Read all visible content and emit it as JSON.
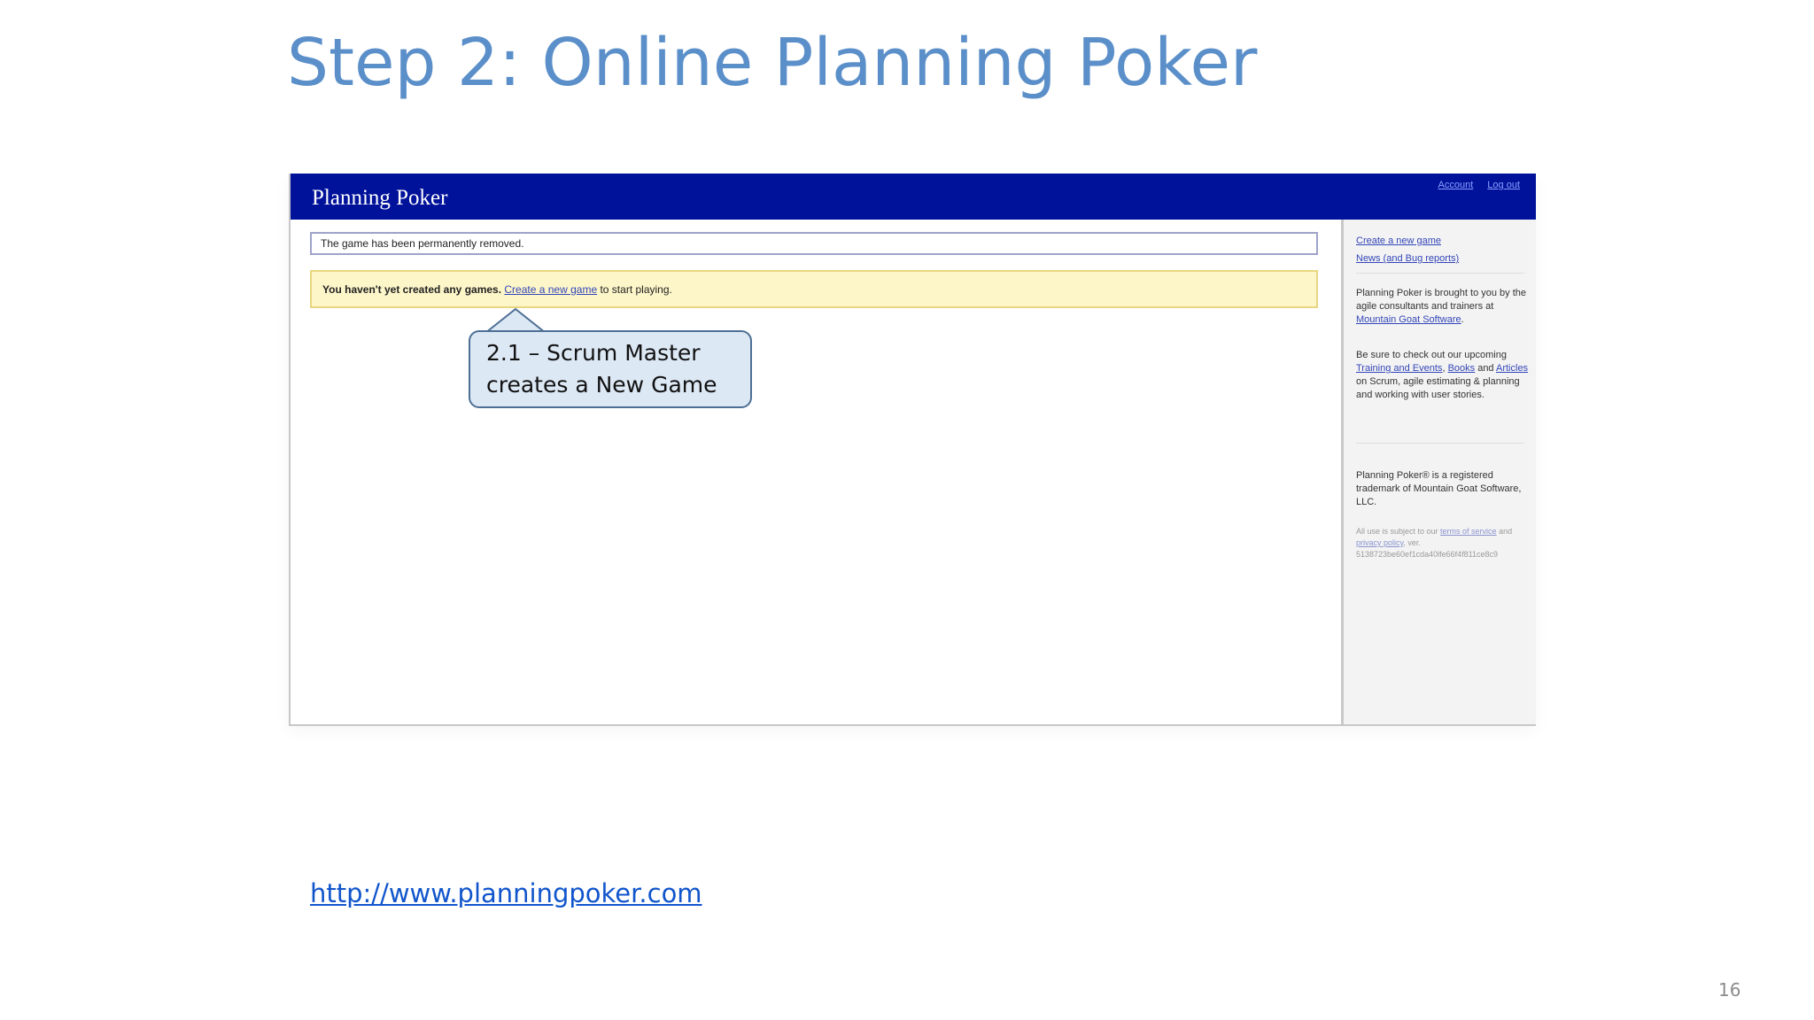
{
  "slide": {
    "title": "Step 2: Online Planning Poker",
    "url": "http://www.planningpoker.com",
    "page_number": "16"
  },
  "site": {
    "title": "Planning Poker",
    "header_links": {
      "account": "Account",
      "logout": "Log out"
    },
    "notice": "The game has been permanently removed.",
    "info": {
      "bold_text": "You haven't yet created any games.",
      "link_text": "Create a new game",
      "suffix": " to start playing."
    },
    "sidebar": {
      "links": [
        "Create a new game",
        "News (and Bug reports)"
      ],
      "about_pre": "Planning Poker is brought to you by the agile consultants and trainers at ",
      "about_link": "Mountain Goat Software",
      "about_post": ".",
      "checkout_pre": "Be sure to check out our upcoming ",
      "checkout_link1": "Training and Events",
      "checkout_sep1": ", ",
      "checkout_link2": "Books",
      "checkout_sep2": " and ",
      "checkout_link3": "Articles",
      "checkout_post": " on Scrum, agile estimating & planning and working with user stories.",
      "trademark": "Planning Poker® is a registered trademark of Mountain Goat Software, LLC.",
      "fine_pre": "All use is subject to our ",
      "fine_link1": "terms of service",
      "fine_sep": " and ",
      "fine_link2": "privacy policy",
      "fine_post": ", ver.",
      "fine_hash": "5138723be60ef1cda40lfe66f4f811ce8c9"
    }
  },
  "callout": {
    "line1": "2.1 – Scrum Master",
    "line2": "creates a New Game"
  },
  "colors": {
    "title": "#5b8fc9",
    "site_header": "#00129a",
    "info_bar": "#fdf6c9",
    "callout_fill": "#dde8f5",
    "callout_border": "#4d6f94",
    "link": "#1155cc"
  }
}
